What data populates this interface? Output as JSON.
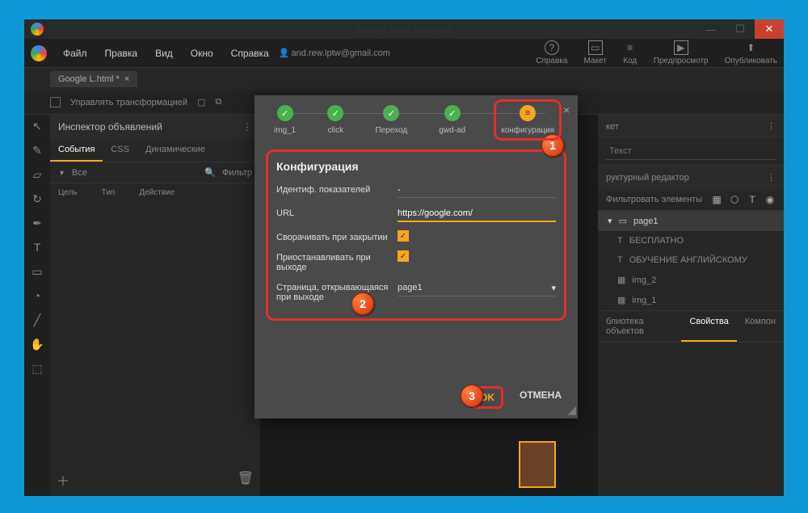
{
  "window": {
    "title": "Google Web Designer"
  },
  "menu": {
    "file": "Файл",
    "edit": "Правка",
    "view": "Вид",
    "window": "Окно",
    "help": "Справка",
    "user": "and.rew.lptw@gmail.com"
  },
  "top_actions": {
    "help": "Справка",
    "layout": "Макет",
    "code": "Код",
    "preview": "Предпросмотр",
    "publish": "Опубликовать"
  },
  "tab": {
    "name": "Google L.html *"
  },
  "toolbar": {
    "manage": "Управлять трансформацией"
  },
  "inspector": {
    "header": "Инспектор объявлений",
    "tabs": {
      "events": "События",
      "css": "CSS",
      "dynamic": "Динамические"
    },
    "filter_all": "Все",
    "search_ph": "Фильтр",
    "cols": {
      "target": "Цель",
      "type": "Тип",
      "action": "Действие"
    }
  },
  "right": {
    "layout_tab": "кет",
    "text_ph": "Текст",
    "struct_header": "руктурный редактор",
    "filter_ph": "Фильтровать элементы",
    "tree": {
      "page": "page1",
      "free": "БЕСПЛАТНО",
      "learn": "ОБУЧЕНИЕ АНГЛИЙСКОМУ",
      "img2": "img_2",
      "img1": "img_1"
    },
    "library": "блиотека объектов",
    "properties": "Свойства",
    "components": "Компон"
  },
  "dialog": {
    "steps": {
      "s1": "img_1",
      "s2": "click",
      "s3": "Переход",
      "s4": "gwd-ad",
      "s5": "конфигурация"
    },
    "title": "Конфигурация",
    "fields": {
      "metrics_label": "Идентиф. показателей",
      "metrics_val": "-",
      "url_label": "URL",
      "url_val": "https://google.com/",
      "collapse_label": "Сворачивать при закрытии",
      "pause_label": "Приостанавливать при выходе",
      "page_label": "Страница, открывающаяся при выходе",
      "page_val": "page1"
    },
    "ok": "OK",
    "cancel": "ОТМЕНА"
  },
  "callouts": {
    "n1": "1",
    "n2": "2",
    "n3": "3"
  }
}
